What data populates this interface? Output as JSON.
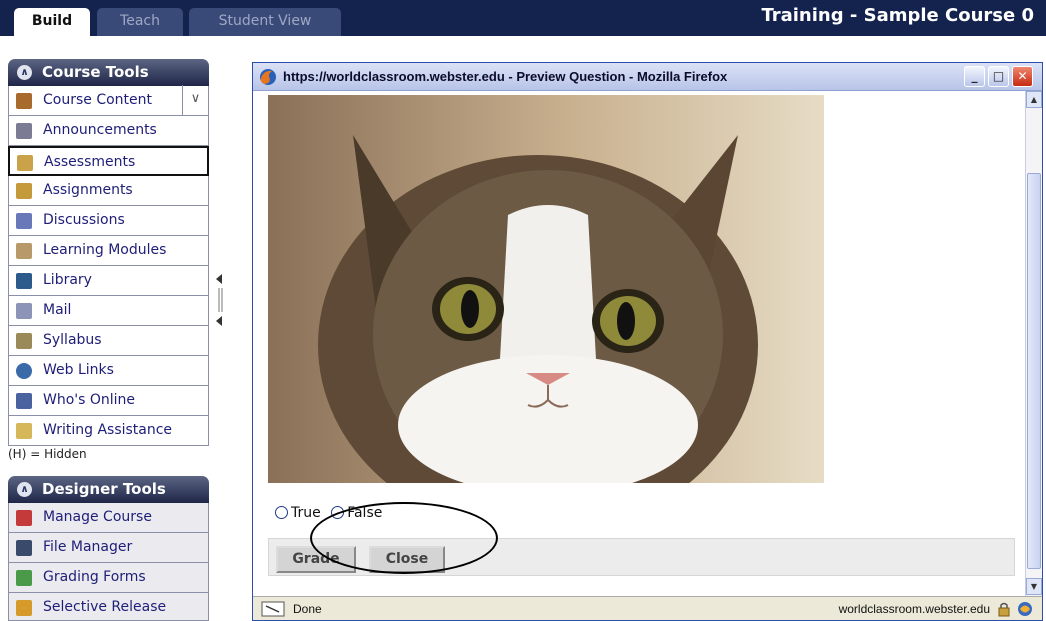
{
  "tabs": [
    {
      "label": "Build",
      "active": true
    },
    {
      "label": "Teach",
      "active": false
    },
    {
      "label": "Student View",
      "active": false
    }
  ],
  "course_title": "Training - Sample Course 0",
  "course_tools": {
    "header": "Course Tools",
    "items": [
      {
        "label": "Course Content",
        "icon": "house-icon"
      },
      {
        "label": "Announcements",
        "icon": "megaphone-icon"
      },
      {
        "label": "Assessments",
        "icon": "clipboard-icon"
      },
      {
        "label": "Assignments",
        "icon": "pencil-icon"
      },
      {
        "label": "Discussions",
        "icon": "pushpin-icon"
      },
      {
        "label": "Learning Modules",
        "icon": "document-icon"
      },
      {
        "label": "Library",
        "icon": "books-icon"
      },
      {
        "label": "Mail",
        "icon": "envelope-icon"
      },
      {
        "label": "Syllabus",
        "icon": "syllabus-icon"
      },
      {
        "label": "Web Links",
        "icon": "globe-icon"
      },
      {
        "label": "Who's Online",
        "icon": "monitor-icon"
      },
      {
        "label": "Writing Assistance",
        "icon": "writing-icon"
      }
    ],
    "hidden_note": "(H) = Hidden"
  },
  "designer_tools": {
    "header": "Designer Tools",
    "items": [
      {
        "label": "Manage Course",
        "icon": "toolbox-icon"
      },
      {
        "label": "File Manager",
        "icon": "cabinet-icon"
      },
      {
        "label": "Grading Forms",
        "icon": "grid-icon"
      },
      {
        "label": "Selective Release",
        "icon": "release-icon"
      }
    ]
  },
  "popup": {
    "title": "https://worldclassroom.webster.edu - Preview Question - Mozilla Firefox",
    "answers": [
      "True",
      "False"
    ],
    "grade_label": "Grade",
    "close_label": "Close",
    "status_text": "Done",
    "status_url": "worldclassroom.webster.edu"
  }
}
